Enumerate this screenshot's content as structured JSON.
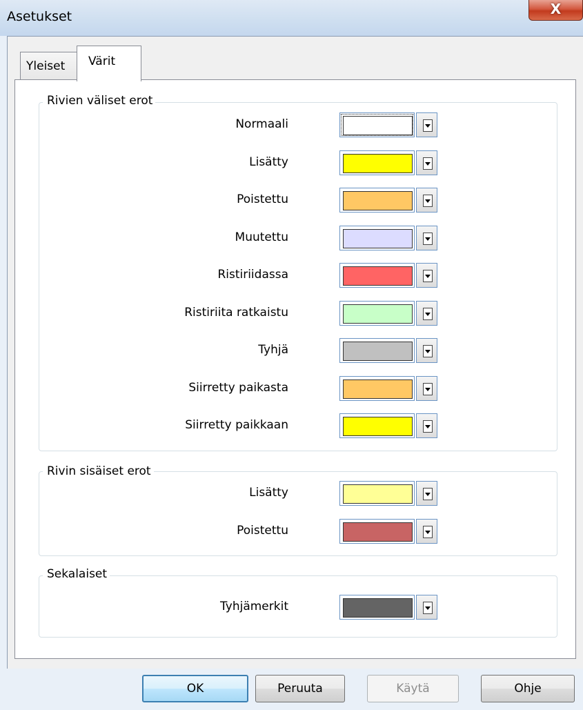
{
  "window": {
    "title": "Asetukset",
    "close_label": "X"
  },
  "tabs": [
    {
      "label": "Yleiset",
      "selected": false
    },
    {
      "label": "Värit",
      "selected": true
    }
  ],
  "groups": {
    "line_diffs": {
      "title": "Rivien väliset erot",
      "items": [
        {
          "label": "Normaali",
          "color": "#ffffff"
        },
        {
          "label": "Lisätty",
          "color": "#ffff00"
        },
        {
          "label": "Poistettu",
          "color": "#ffc864"
        },
        {
          "label": "Muutettu",
          "color": "#dcdcff"
        },
        {
          "label": "Ristiriidassa",
          "color": "#ff6464"
        },
        {
          "label": "Ristiriita ratkaistu",
          "color": "#c8ffc8"
        },
        {
          "label": "Tyhjä",
          "color": "#c0c0c0"
        },
        {
          "label": "Siirretty paikasta",
          "color": "#ffc864"
        },
        {
          "label": "Siirretty paikkaan",
          "color": "#ffff00"
        }
      ]
    },
    "inline_diffs": {
      "title": "Rivin sisäiset erot",
      "items": [
        {
          "label": "Lisätty",
          "color": "#ffff96"
        },
        {
          "label": "Poistettu",
          "color": "#c86464"
        }
      ]
    },
    "misc": {
      "title": "Sekalaiset",
      "items": [
        {
          "label": "Tyhjämerkit",
          "color": "#646464"
        }
      ]
    }
  },
  "buttons": {
    "ok": "OK",
    "cancel": "Peruuta",
    "apply": "Käytä",
    "help": "Ohje"
  }
}
